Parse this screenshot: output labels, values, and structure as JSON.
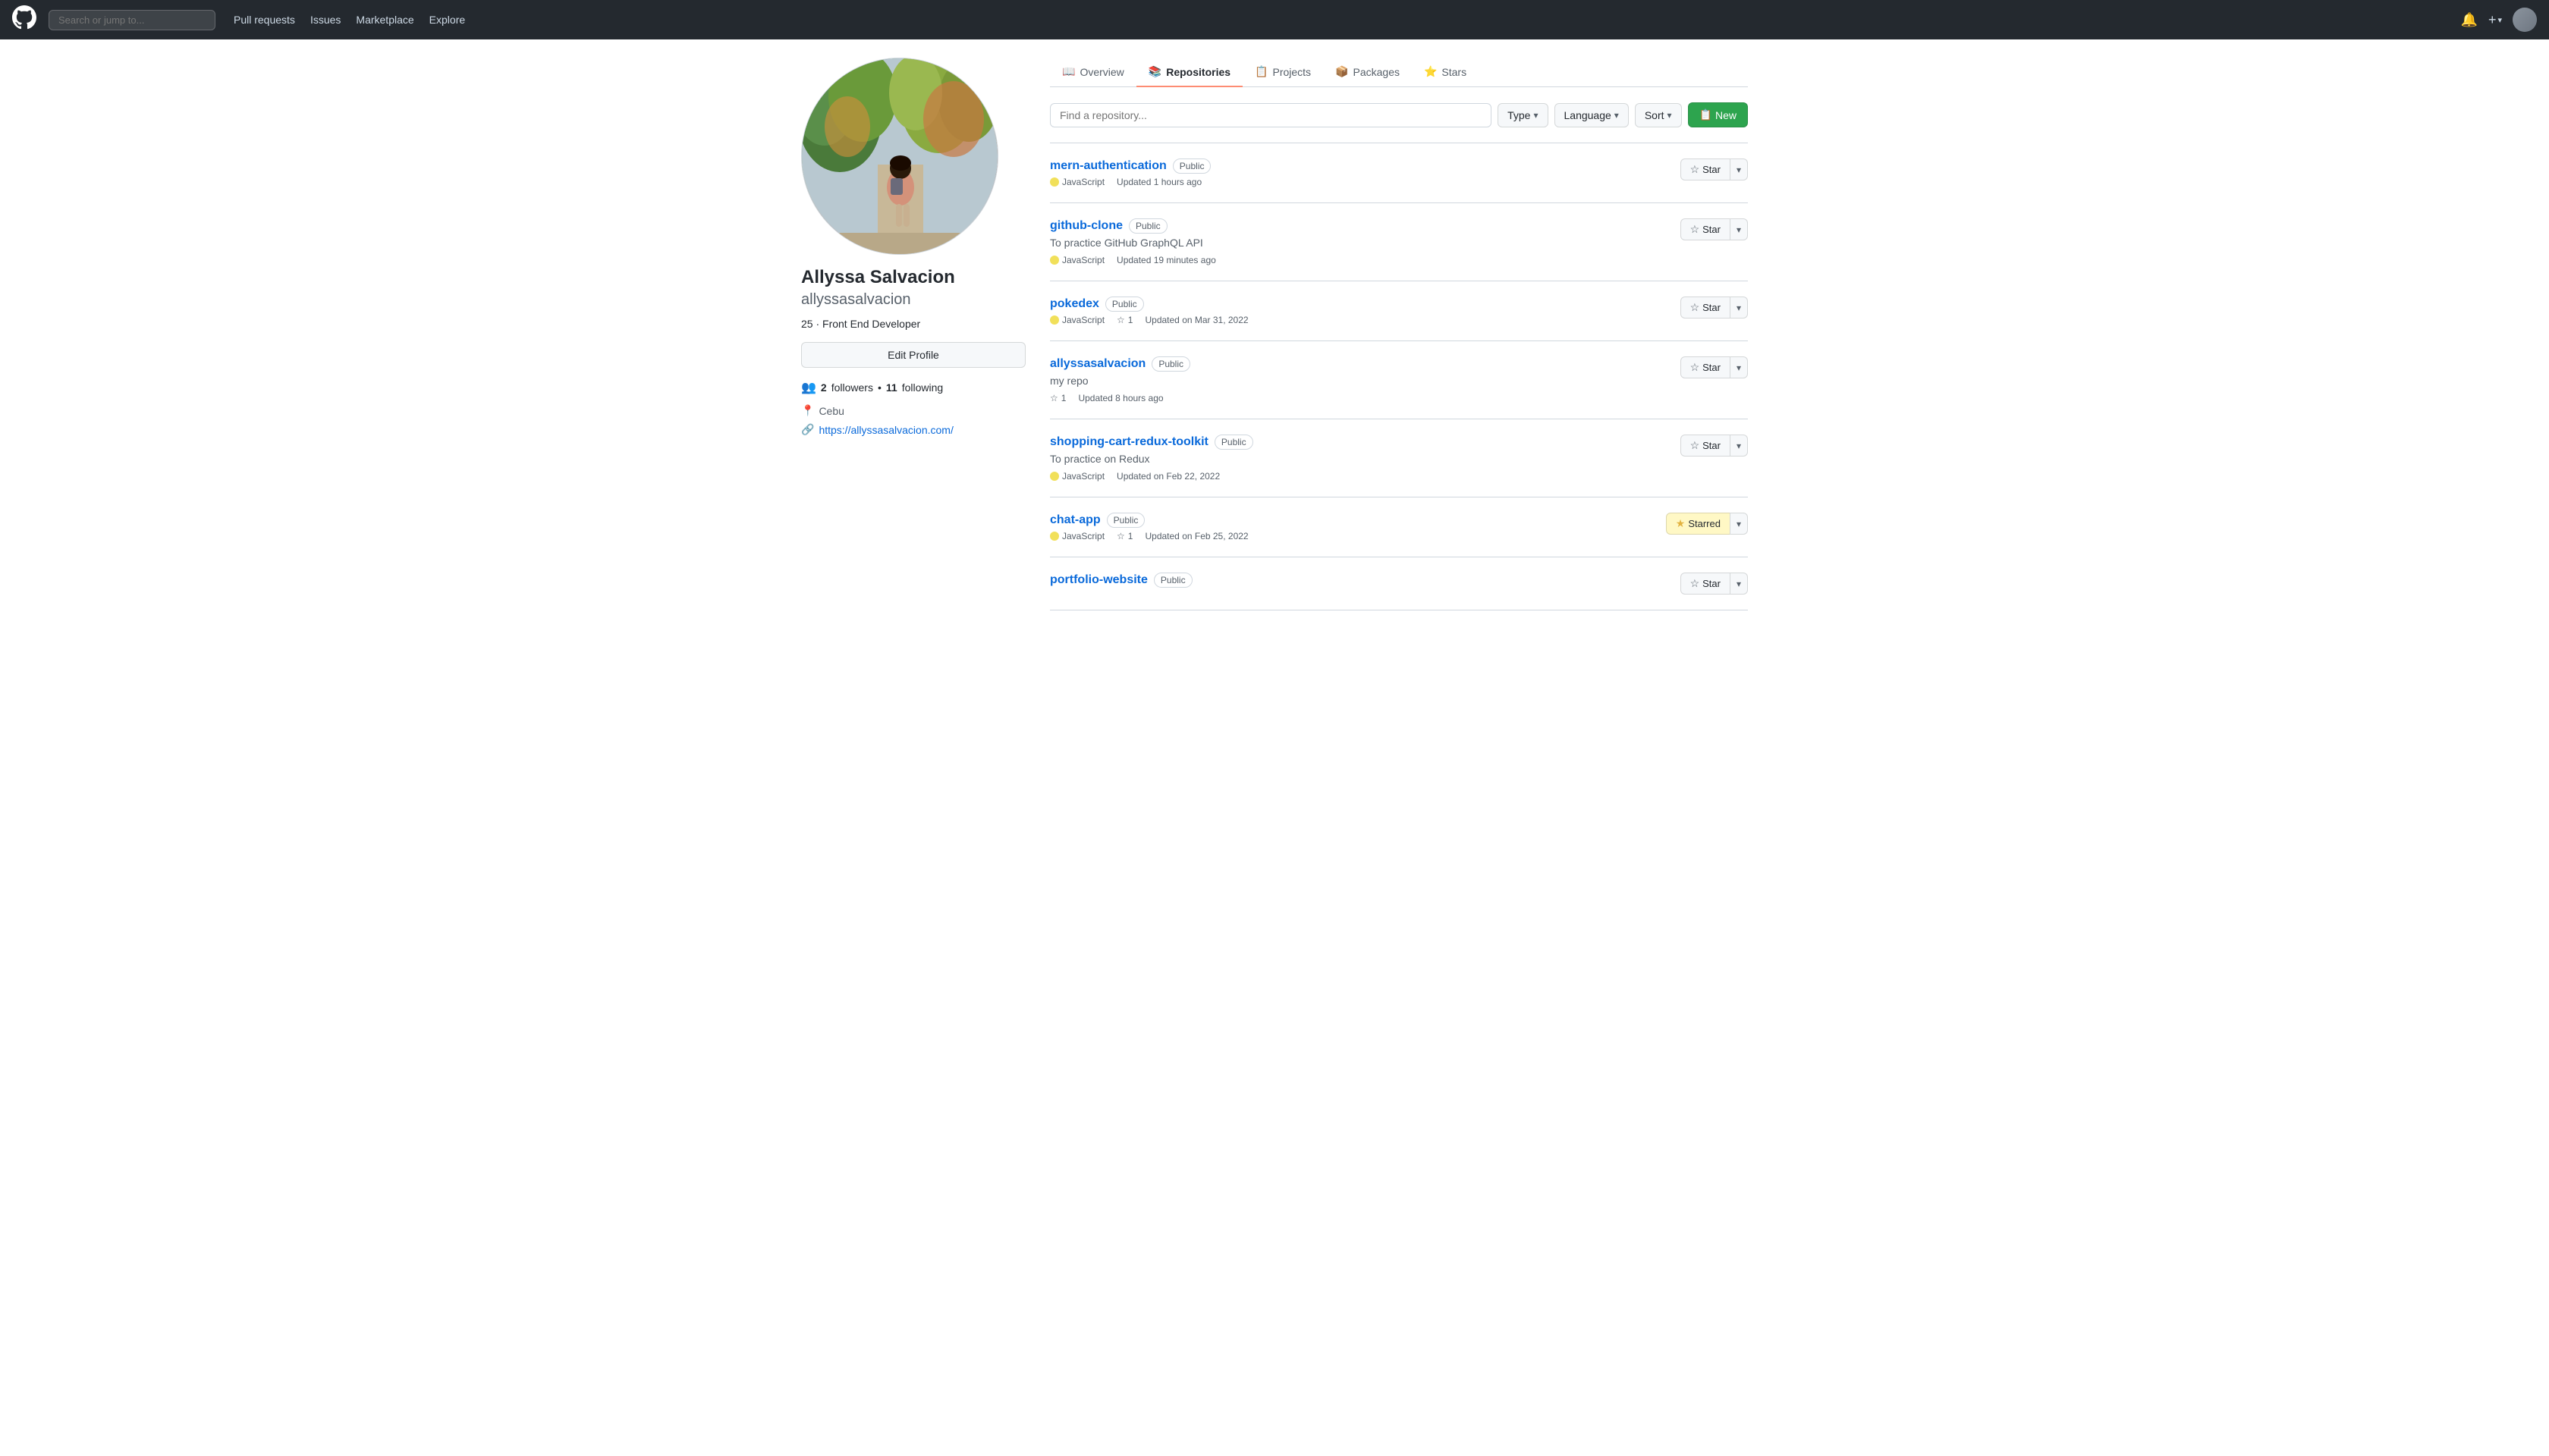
{
  "navbar": {
    "logo_label": "GitHub",
    "search_placeholder": "Search or jump to...",
    "links": [
      {
        "label": "Pull requests",
        "name": "pull-requests"
      },
      {
        "label": "Issues",
        "name": "issues"
      },
      {
        "label": "Marketplace",
        "name": "marketplace"
      },
      {
        "label": "Explore",
        "name": "explore"
      }
    ],
    "bell_icon": "🔔",
    "plus_label": "+",
    "chevron": "▾"
  },
  "sidebar": {
    "profile_name": "Allyssa Salvacion",
    "profile_username": "allyssasalvacion",
    "profile_bio": "25 · Front End Developer",
    "edit_profile_label": "Edit Profile",
    "followers_count": "2",
    "followers_label": "followers",
    "following_sep": "•",
    "following_count": "11",
    "following_label": "following",
    "location": "Cebu",
    "website_url": "https://allyssasalvacion.com/",
    "website_label": "https://allyssasalvacion.com/"
  },
  "tabs": [
    {
      "label": "Overview",
      "icon": "📖",
      "active": false,
      "name": "overview"
    },
    {
      "label": "Repositories",
      "icon": "📚",
      "active": true,
      "name": "repositories"
    },
    {
      "label": "Projects",
      "icon": "📋",
      "active": false,
      "name": "projects"
    },
    {
      "label": "Packages",
      "icon": "📦",
      "active": false,
      "name": "packages"
    },
    {
      "label": "Stars",
      "icon": "⭐",
      "active": false,
      "name": "stars"
    }
  ],
  "toolbar": {
    "search_placeholder": "Find a repository...",
    "type_label": "Type",
    "language_label": "Language",
    "sort_label": "Sort",
    "new_label": "New",
    "new_icon": "📋"
  },
  "repos": [
    {
      "name": "mern-authentication",
      "badge": "Public",
      "description": "",
      "language": "JavaScript",
      "lang_color": "#f1e05a",
      "stars": "",
      "updated": "Updated 1 hours ago",
      "starred": false
    },
    {
      "name": "github-clone",
      "badge": "Public",
      "description": "To practice GitHub GraphQL API",
      "language": "JavaScript",
      "lang_color": "#f1e05a",
      "stars": "",
      "updated": "Updated 19 minutes ago",
      "starred": false
    },
    {
      "name": "pokedex",
      "badge": "Public",
      "description": "",
      "language": "JavaScript",
      "lang_color": "#f1e05a",
      "stars": "1",
      "updated": "Updated on Mar 31, 2022",
      "starred": false
    },
    {
      "name": "allyssasalvacion",
      "badge": "Public",
      "description": "my repo",
      "language": "",
      "lang_color": "",
      "stars": "1",
      "updated": "Updated 8 hours ago",
      "starred": false
    },
    {
      "name": "shopping-cart-redux-toolkit",
      "badge": "Public",
      "description": "To practice on Redux",
      "language": "JavaScript",
      "lang_color": "#f1e05a",
      "stars": "",
      "updated": "Updated on Feb 22, 2022",
      "starred": false
    },
    {
      "name": "chat-app",
      "badge": "Public",
      "description": "",
      "language": "JavaScript",
      "lang_color": "#f1e05a",
      "stars": "1",
      "updated": "Updated on Feb 25, 2022",
      "starred": true
    },
    {
      "name": "portfolio-website",
      "badge": "Public",
      "description": "",
      "language": "",
      "lang_color": "",
      "stars": "",
      "updated": "",
      "starred": false
    }
  ],
  "star_label": "Star",
  "starred_label": "Starred"
}
